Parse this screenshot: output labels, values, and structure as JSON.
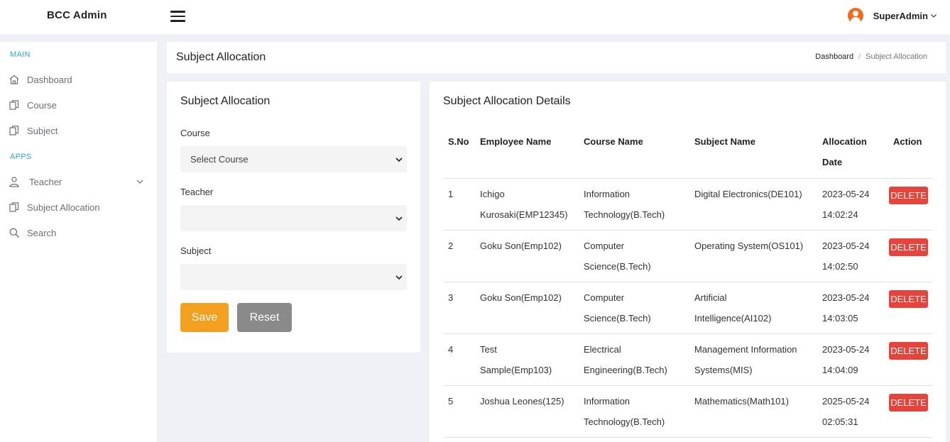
{
  "app": {
    "brand": "BCC Admin"
  },
  "user": {
    "name": "SuperAdmin"
  },
  "sidebar": {
    "sections": [
      "MAIN",
      "APPS"
    ],
    "items": [
      {
        "label": "Dashboard",
        "icon": "home-icon"
      },
      {
        "label": "Course",
        "icon": "copy-icon"
      },
      {
        "label": "Subject",
        "icon": "copy-icon"
      },
      {
        "label": "Teacher",
        "icon": "user-icon"
      },
      {
        "label": "Subject Allocation",
        "icon": "copy-icon"
      },
      {
        "label": "Search",
        "icon": "search-icon"
      }
    ]
  },
  "header": {
    "title": "Subject Allocation",
    "breadcrumb": [
      "Dashboard",
      "Subject Allocation"
    ],
    "breadcrumb_separator": "/"
  },
  "form": {
    "title": "Subject Allocation",
    "course_label": "Course",
    "course_value": "Select Course",
    "teacher_label": "Teacher",
    "teacher_value": "",
    "subject_label": "Subject",
    "subject_value": "",
    "save_label": "Save",
    "reset_label": "Reset"
  },
  "table": {
    "title": "Subject Allocation Details",
    "headers": [
      "S.No",
      "Employee Name",
      "Course Name",
      "Subject Name",
      "Allocation Date",
      "Action"
    ],
    "header_lines": {
      "date1": "Allocation",
      "date2": "Date"
    },
    "rows": [
      {
        "sno": "1",
        "emp1": "Ichigo",
        "emp2": "Kurosaki(EMP12345)",
        "course1": "Information",
        "course2": "Technology(B.Tech)",
        "subject1": "Digital Electronics(DE101)",
        "subject2": "",
        "date1": "2023-05-24",
        "date2": "14:02:24",
        "action": "DELETE"
      },
      {
        "sno": "2",
        "emp1": "Goku Son(Emp102)",
        "emp2": "",
        "course1": "Computer",
        "course2": "Science(B.Tech)",
        "subject1": "Operating System(OS101)",
        "subject2": "",
        "date1": "2023-05-24",
        "date2": "14:02:50",
        "action": "DELETE"
      },
      {
        "sno": "3",
        "emp1": "Goku Son(Emp102)",
        "emp2": "",
        "course1": "Computer",
        "course2": "Science(B.Tech)",
        "subject1": "Artificial",
        "subject2": "Intelligence(AI102)",
        "date1": "2023-05-24",
        "date2": "14:03:05",
        "action": "DELETE"
      },
      {
        "sno": "4",
        "emp1": "Test",
        "emp2": "Sample(Emp103)",
        "course1": "Electrical",
        "course2": "Engineering(B.Tech)",
        "subject1": "Management Information",
        "subject2": "Systems(MIS)",
        "date1": "2023-05-24",
        "date2": "14:04:09",
        "action": "DELETE"
      },
      {
        "sno": "5",
        "emp1": "Joshua Leones(125)",
        "emp2": "",
        "course1": "Information",
        "course2": "Technology(B.Tech)",
        "subject1": "Mathematics(Math101)",
        "subject2": "",
        "date1": "2025-05-24",
        "date2": "02:05:31",
        "action": "DELETE"
      }
    ]
  },
  "colors": {
    "accent_section": "#2aa3d8",
    "save": "#f2a01e",
    "reset": "#8a8a8a",
    "delete": "#e6433a",
    "user_icon": "#f26b1d"
  }
}
